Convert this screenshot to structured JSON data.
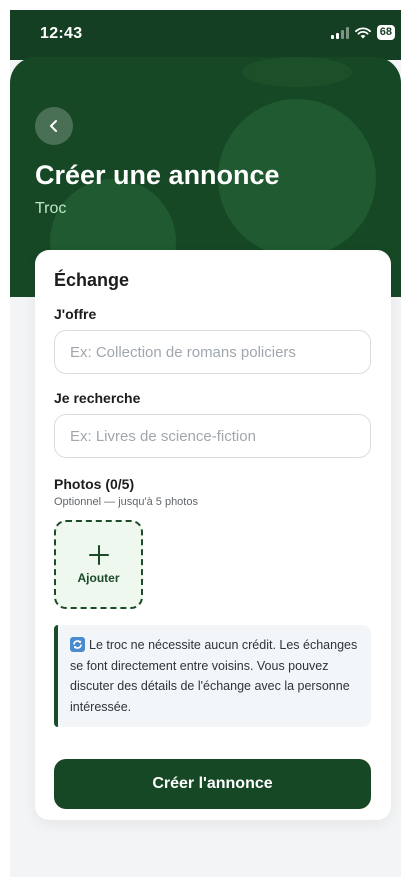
{
  "status_bar": {
    "time": "12:43",
    "battery": "68"
  },
  "header": {
    "title": "Créer une annonce",
    "subtitle": "Troc",
    "back_icon": "chevron-left-icon"
  },
  "form": {
    "section_title": "Échange",
    "offer": {
      "label": "J'offre",
      "placeholder": "Ex: Collection de romans policiers",
      "value": ""
    },
    "search": {
      "label": "Je recherche",
      "placeholder": "Ex: Livres de science-fiction",
      "value": ""
    },
    "photos": {
      "title": "Photos (0/5)",
      "hint": "Optionnel — jusqu'à 5 photos",
      "add_label": "Ajouter"
    },
    "info": {
      "icon": "refresh-icon",
      "text": "Le troc ne nécessite aucun crédit. Les échanges se font directement entre voisins. Vous pouvez discuter des détails de l'échange avec la personne intéressée."
    },
    "submit_label": "Créer l'annonce"
  },
  "colors": {
    "brand_dark_green": "#174826",
    "accent_light_green": "#bfe7c4",
    "info_icon_blue": "#4a8bd0"
  }
}
